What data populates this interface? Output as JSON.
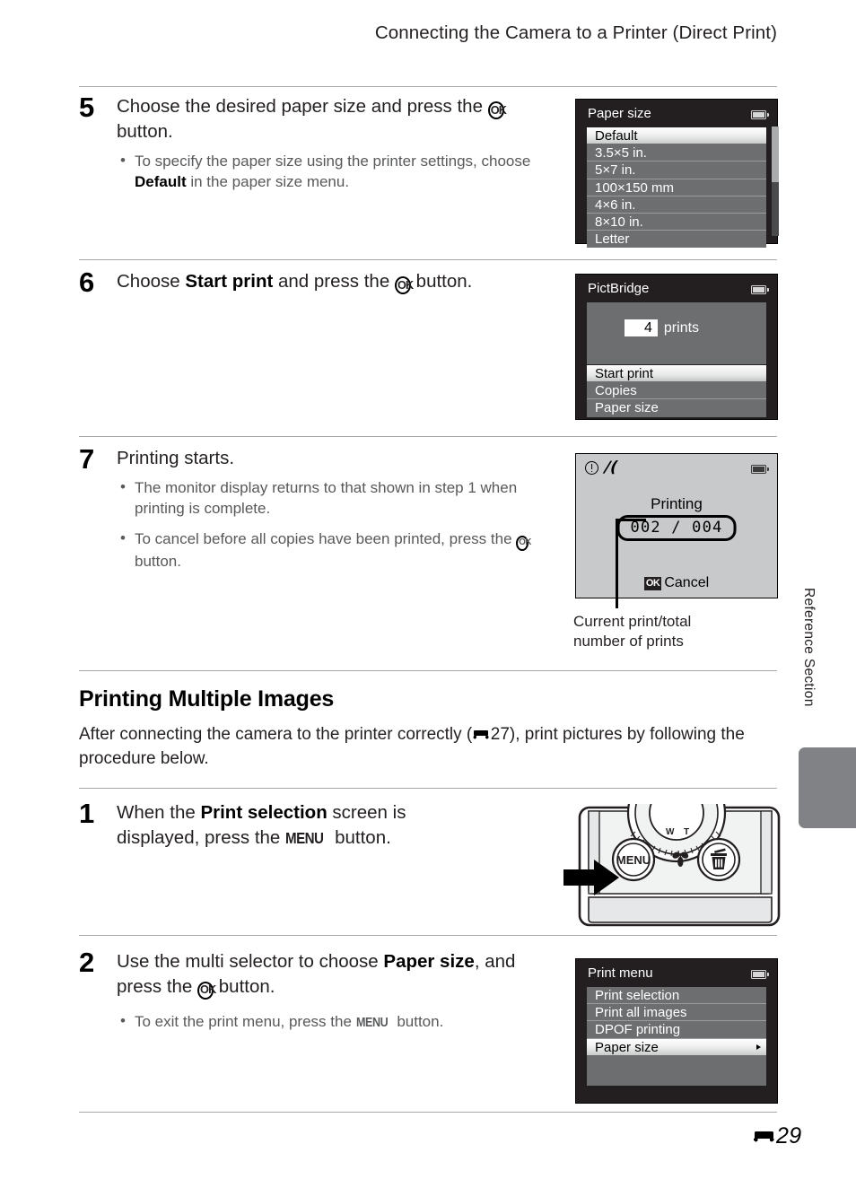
{
  "header": {
    "running_head": "Connecting the Camera to a Printer (Direct Print)"
  },
  "steps": [
    {
      "number": "5",
      "title_pre": "Choose the desired paper size and press the ",
      "title_icon": "OK",
      "title_post": " button.",
      "bullets": [
        {
          "pre": "To specify the paper size using the printer settings, choose ",
          "bold": "Default",
          "post": " in the paper size menu."
        }
      ]
    },
    {
      "number": "6",
      "title_pre": "Choose ",
      "title_bold": "Start print",
      "title_mid": " and press the ",
      "title_icon": "OK",
      "title_post": " button.",
      "bullets": []
    },
    {
      "number": "7",
      "title_pre": "Printing starts.",
      "bullets": [
        {
          "pre": "The monitor display returns to that shown in step 1 when printing is complete.",
          "bold": "",
          "post": ""
        },
        {
          "pre": "To cancel before all copies have been printed, press the ",
          "icon": "OK",
          "post": " button."
        }
      ]
    }
  ],
  "screens": {
    "paper_size": {
      "title": "Paper size",
      "battery_icon": "battery-icon",
      "items": [
        {
          "label": "Default",
          "selected": true
        },
        {
          "label": "3.5×5 in.",
          "selected": false
        },
        {
          "label": "5×7 in.",
          "selected": false
        },
        {
          "label": "100×150 mm",
          "selected": false
        },
        {
          "label": "4×6 in.",
          "selected": false
        },
        {
          "label": "8×10 in.",
          "selected": false
        },
        {
          "label": "Letter",
          "selected": false
        }
      ]
    },
    "pictbridge": {
      "title": "PictBridge",
      "battery_icon": "battery-icon",
      "count_value": "4",
      "count_label": "prints",
      "items": [
        {
          "label": "Start print",
          "selected": true
        },
        {
          "label": "Copies",
          "selected": false
        },
        {
          "label": "Paper size",
          "selected": false
        }
      ]
    },
    "printing": {
      "warning_icons": [
        "exclamation-icon",
        "camera-shake-icon"
      ],
      "battery_icon": "battery-icon",
      "status": "Printing",
      "count": "002 / 004",
      "cancel_icon": "OK",
      "cancel_label": "Cancel"
    },
    "print_menu": {
      "title": "Print menu",
      "battery_icon": "battery-icon",
      "items": [
        {
          "label": "Print selection",
          "selected": false,
          "arrow": false
        },
        {
          "label": "Print all images",
          "selected": false,
          "arrow": false
        },
        {
          "label": "DPOF printing",
          "selected": false,
          "arrow": false
        },
        {
          "label": "Paper size",
          "selected": true,
          "arrow": true
        }
      ]
    }
  },
  "callout": {
    "caption_line1": "Current print/total",
    "caption_line2": "number of prints"
  },
  "section": {
    "heading": "Printing Multiple Images",
    "body_pre": "After connecting the camera to the printer correctly (",
    "body_ref_page": "27",
    "body_post": "), print pictures by following the procedure below."
  },
  "steps2": [
    {
      "number": "1",
      "title_pre": "When the ",
      "title_bold": "Print selection",
      "title_mid": " screen is displayed, press the ",
      "title_icon": "MENU",
      "title_post": " button.",
      "bullets": []
    },
    {
      "number": "2",
      "title_pre": "Use the multi selector to choose ",
      "title_bold": "Paper size",
      "title_mid": ", and press the ",
      "title_icon": "OK",
      "title_post": " button.",
      "bullets": [
        {
          "pre": "To exit the print menu, press the ",
          "icon": "MENU",
          "post": " button."
        }
      ]
    }
  ],
  "camera_illustration": {
    "menu_button_label": "MENU",
    "macro_icon": "macro-flower-icon",
    "delete_icon": "trash-delete-icon",
    "pointer_icon": "black-arrow-icon"
  },
  "side_tab": {
    "label": "Reference Section",
    "tab_color": "#808285"
  },
  "footer": {
    "page_number": "29",
    "section_glyph": "reference-section-glyph"
  }
}
